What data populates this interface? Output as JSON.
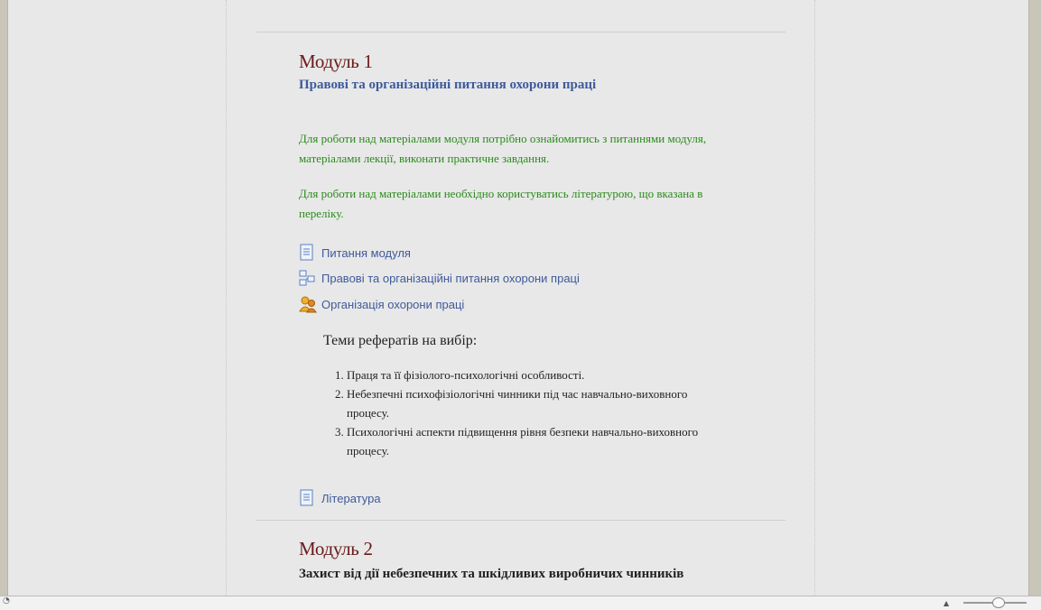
{
  "module1": {
    "title": "Модуль 1",
    "subtitle": "Правові та організаційні питання охорони праці",
    "para1": "Для роботи над матеріалами модуля потрібно ознайомитись з питаннями модуля, матеріалами лекції, виконати практичне завдання.",
    "para2": "Для роботи над матеріалами необхідно користуватись літературою, що вказана в переліку.",
    "resources": [
      {
        "label": "Питання модуля",
        "icon": "document-icon"
      },
      {
        "label": "Правові та організаційні питання охорони праці",
        "icon": "folder-tree-icon"
      },
      {
        "label": "Організація охорони праці",
        "icon": "users-icon"
      }
    ],
    "themes_title": "Теми рефератів на вибір:",
    "themes": [
      "Праця та її фізіолого-психологічні особливості.",
      "Небезпечні психофізіологічні чинники під час навчально-виховного процесу.",
      "Психологічні аспекти підвищення рівня безпеки навчально-виховного процесу."
    ],
    "literature": {
      "label": "Література",
      "icon": "document-icon"
    }
  },
  "module2": {
    "title": "Модуль 2",
    "subtitle": "Захист від дії небезпечних та шкідливих виробничих чинників"
  },
  "colors": {
    "module_title": "#6b1a1a",
    "subtitle_blue": "#3e5a9a",
    "green_text": "#2b8a1c",
    "link": "#3e5a9a"
  }
}
